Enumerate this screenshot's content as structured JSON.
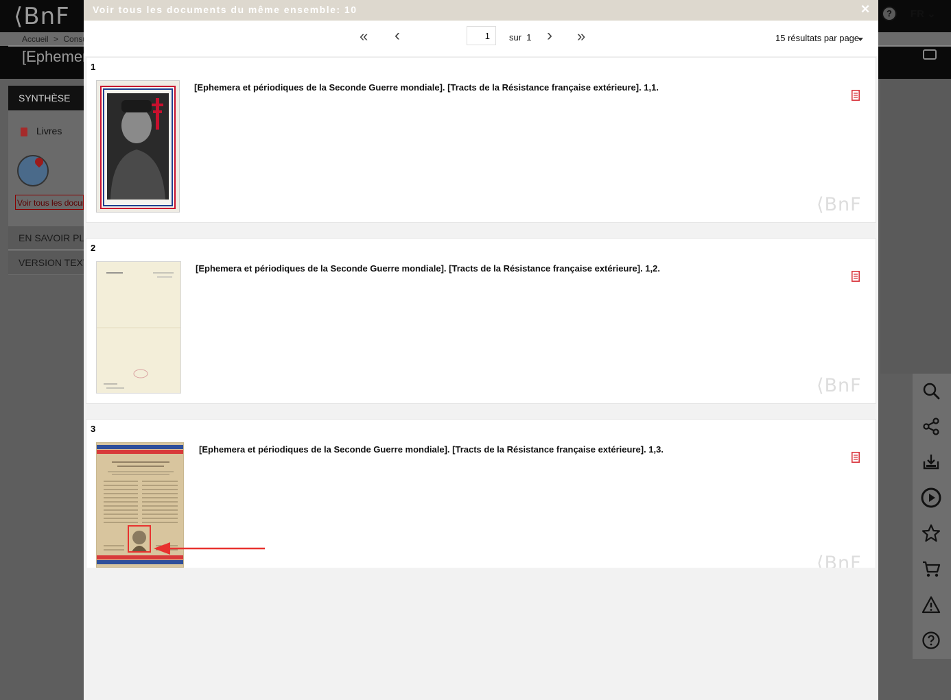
{
  "background": {
    "logo": "⟨BnF",
    "breadcrumb_home": "Accueil",
    "breadcrumb_sep": ">",
    "breadcrumb_current": "Consult",
    "title": "[Ephemera",
    "lang": "FR ⌄",
    "help": "?",
    "sidebar": {
      "synthese": "SYNTHÈSE",
      "livres": "Livres",
      "voir_tous": "Voir tous les docume",
      "en_savoir_plus": "EN SAVOIR PLUS",
      "version_texte": "VERSION TEXTE ("
    },
    "tools": [
      "search-icon",
      "share-icon",
      "download-icon",
      "play-icon",
      "star-icon",
      "cart-icon",
      "warning-icon",
      "help-icon"
    ]
  },
  "modal": {
    "title": "Voir tous les documents du même ensemble: 10",
    "close": "✕",
    "pager": {
      "first": "«",
      "prev": "‹",
      "page": "1",
      "of_label": "sur  1",
      "next": "›",
      "last": "»",
      "per_page": "15 résultats par page"
    },
    "results": [
      {
        "num": "1",
        "title": "[Ephemera et périodiques de la Seconde Guerre mondiale]. [Tracts de la Résistance française extérieure]. 1,1.",
        "watermark": "⟨BnF"
      },
      {
        "num": "2",
        "title": "[Ephemera et périodiques de la Seconde Guerre mondiale]. [Tracts de la Résistance française extérieure]. 1,2.",
        "watermark": "⟨BnF"
      },
      {
        "num": "3",
        "title": "[Ephemera et périodiques de la Seconde Guerre mondiale]. [Tracts de la Résistance française extérieure]. 1,3.",
        "watermark": "⟨BnF"
      }
    ]
  },
  "colors": {
    "accent_red": "#e8322f",
    "modal_header": "#ddd8ce",
    "doc_icon": "#d9363e"
  }
}
